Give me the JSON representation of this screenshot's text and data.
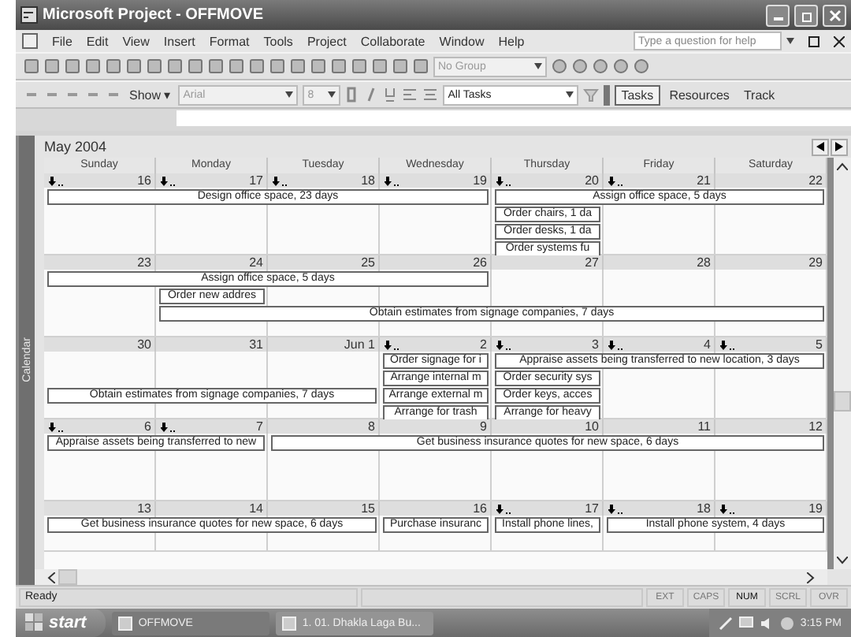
{
  "window": {
    "title": "Microsoft Project - OFFMOVE"
  },
  "menu": [
    "File",
    "Edit",
    "View",
    "Insert",
    "Format",
    "Tools",
    "Project",
    "Collaborate",
    "Window",
    "Help"
  ],
  "help_box": {
    "placeholder": "Type a question for help"
  },
  "toolbar": {
    "group_box": {
      "value": "No Group"
    }
  },
  "formatting": {
    "show_button": "Show ▾",
    "font_box": {
      "value": "Arial"
    },
    "size_box": {
      "value": "8"
    },
    "filter_box": {
      "value": "All Tasks"
    }
  },
  "guide_buttons": [
    "Tasks",
    "Resources",
    "Track"
  ],
  "calendar": {
    "side_label": "Calendar",
    "month": "May 2004",
    "weekdays": [
      "Sunday",
      "Monday",
      "Tuesday",
      "Wednesday",
      "Thursday",
      "Friday",
      "Saturday"
    ],
    "weeks": [
      {
        "dates": [
          {
            "label": "16",
            "overflow": true
          },
          {
            "label": "17",
            "overflow": true
          },
          {
            "label": "18",
            "overflow": true
          },
          {
            "label": "19",
            "overflow": true
          },
          {
            "label": "20",
            "overflow": true
          },
          {
            "label": "21",
            "overflow": true
          },
          {
            "label": "22",
            "overflow": false
          }
        ],
        "lanes": [
          [
            {
              "kind": "bar",
              "label": "Design office space, 23 days"
            },
            {
              "kind": "cont"
            },
            {
              "kind": "cont"
            },
            {
              "kind": "cont"
            },
            {
              "kind": "bar",
              "label": "Assign office space, 5 days"
            },
            {
              "kind": "cont"
            },
            {
              "kind": "cont"
            }
          ],
          [
            {
              "kind": "empty"
            },
            {
              "kind": "empty"
            },
            {
              "kind": "empty"
            },
            {
              "kind": "empty"
            },
            {
              "kind": "bar",
              "label": "Order chairs, 1 da"
            },
            {
              "kind": "empty"
            },
            {
              "kind": "empty"
            }
          ],
          [
            {
              "kind": "empty"
            },
            {
              "kind": "empty"
            },
            {
              "kind": "empty"
            },
            {
              "kind": "empty"
            },
            {
              "kind": "bar",
              "label": "Order desks, 1 da"
            },
            {
              "kind": "empty"
            },
            {
              "kind": "empty"
            }
          ],
          [
            {
              "kind": "empty"
            },
            {
              "kind": "empty"
            },
            {
              "kind": "empty"
            },
            {
              "kind": "empty"
            },
            {
              "kind": "bar",
              "label": "Order systems fu"
            },
            {
              "kind": "empty"
            },
            {
              "kind": "empty"
            }
          ]
        ]
      },
      {
        "dates": [
          {
            "label": "23",
            "overflow": false
          },
          {
            "label": "24",
            "overflow": false
          },
          {
            "label": "25",
            "overflow": false
          },
          {
            "label": "26",
            "overflow": false
          },
          {
            "label": "27",
            "overflow": false
          },
          {
            "label": "28",
            "overflow": false
          },
          {
            "label": "29",
            "overflow": false
          }
        ],
        "lanes": [
          [
            {
              "kind": "bar",
              "label": "Assign office space, 5 days"
            },
            {
              "kind": "cont"
            },
            {
              "kind": "cont"
            },
            {
              "kind": "cont"
            },
            {
              "kind": "empty"
            },
            {
              "kind": "empty"
            },
            {
              "kind": "empty"
            }
          ],
          [
            {
              "kind": "empty"
            },
            {
              "kind": "bar",
              "label": "Order new addres"
            },
            {
              "kind": "empty"
            },
            {
              "kind": "empty"
            },
            {
              "kind": "empty"
            },
            {
              "kind": "empty"
            },
            {
              "kind": "empty"
            }
          ],
          [
            {
              "kind": "empty"
            },
            {
              "kind": "bar",
              "label": "Obtain estimates from signage companies, 7 days"
            },
            {
              "kind": "cont"
            },
            {
              "kind": "cont"
            },
            {
              "kind": "cont"
            },
            {
              "kind": "cont"
            },
            {
              "kind": "cont"
            }
          ]
        ]
      },
      {
        "dates": [
          {
            "label": "30",
            "overflow": false
          },
          {
            "label": "31",
            "overflow": false
          },
          {
            "label": "Jun 1",
            "overflow": false
          },
          {
            "label": "2",
            "overflow": true
          },
          {
            "label": "3",
            "overflow": true
          },
          {
            "label": "4",
            "overflow": true
          },
          {
            "label": "5",
            "overflow": true
          }
        ],
        "lanes": [
          [
            {
              "kind": "empty"
            },
            {
              "kind": "empty"
            },
            {
              "kind": "empty"
            },
            {
              "kind": "bar",
              "label": "Order signage for i"
            },
            {
              "kind": "bar",
              "label": "Appraise assets being transferred to new location, 3 days"
            },
            {
              "kind": "cont"
            },
            {
              "kind": "cont"
            }
          ],
          [
            {
              "kind": "empty"
            },
            {
              "kind": "empty"
            },
            {
              "kind": "empty"
            },
            {
              "kind": "bar",
              "label": "Arrange internal m"
            },
            {
              "kind": "bar",
              "label": "Order security sys"
            },
            {
              "kind": "empty"
            },
            {
              "kind": "empty"
            }
          ],
          [
            {
              "kind": "bar",
              "label": "Obtain estimates from signage companies, 7 days"
            },
            {
              "kind": "cont"
            },
            {
              "kind": "cont"
            },
            {
              "kind": "bar",
              "label": "Arrange external m"
            },
            {
              "kind": "bar",
              "label": "Order keys, acces"
            },
            {
              "kind": "empty"
            },
            {
              "kind": "empty"
            }
          ],
          [
            {
              "kind": "empty"
            },
            {
              "kind": "empty"
            },
            {
              "kind": "empty"
            },
            {
              "kind": "bar",
              "label": "Arrange for trash"
            },
            {
              "kind": "bar",
              "label": "Arrange for heavy"
            },
            {
              "kind": "empty"
            },
            {
              "kind": "empty"
            }
          ]
        ]
      },
      {
        "dates": [
          {
            "label": "6",
            "overflow": true
          },
          {
            "label": "7",
            "overflow": true
          },
          {
            "label": "8",
            "overflow": false
          },
          {
            "label": "9",
            "overflow": false
          },
          {
            "label": "10",
            "overflow": false
          },
          {
            "label": "11",
            "overflow": false
          },
          {
            "label": "12",
            "overflow": false
          }
        ],
        "lanes": [
          [
            {
              "kind": "bar",
              "label": "Appraise assets being transferred to new"
            },
            {
              "kind": "cont"
            },
            {
              "kind": "bar",
              "label": "Get business insurance quotes for new space, 6 days"
            },
            {
              "kind": "cont"
            },
            {
              "kind": "cont"
            },
            {
              "kind": "cont"
            },
            {
              "kind": "cont"
            }
          ]
        ]
      },
      {
        "dates": [
          {
            "label": "13",
            "overflow": false
          },
          {
            "label": "14",
            "overflow": false
          },
          {
            "label": "15",
            "overflow": false
          },
          {
            "label": "16",
            "overflow": false
          },
          {
            "label": "17",
            "overflow": true
          },
          {
            "label": "18",
            "overflow": true
          },
          {
            "label": "19",
            "overflow": true
          }
        ],
        "lanes": [
          [
            {
              "kind": "bar",
              "label": "Get business insurance quotes for new space, 6 days"
            },
            {
              "kind": "cont"
            },
            {
              "kind": "cont"
            },
            {
              "kind": "bar",
              "label": "Purchase insuranc"
            },
            {
              "kind": "bar",
              "label": "Install phone lines,"
            },
            {
              "kind": "bar",
              "label": "Install phone system, 4 days"
            },
            {
              "kind": "cont"
            }
          ]
        ]
      }
    ]
  },
  "status_bar": {
    "text": "Ready",
    "indicators": [
      {
        "label": "EXT",
        "on": false
      },
      {
        "label": "CAPS",
        "on": false
      },
      {
        "label": "NUM",
        "on": true
      },
      {
        "label": "SCRL",
        "on": false
      },
      {
        "label": "OVR",
        "on": false
      }
    ]
  },
  "taskbar": {
    "start": "start",
    "tasks": [
      "OFFMOVE",
      "1. 01. Dhakla Laga Bu..."
    ],
    "clock": "3:15 PM"
  }
}
